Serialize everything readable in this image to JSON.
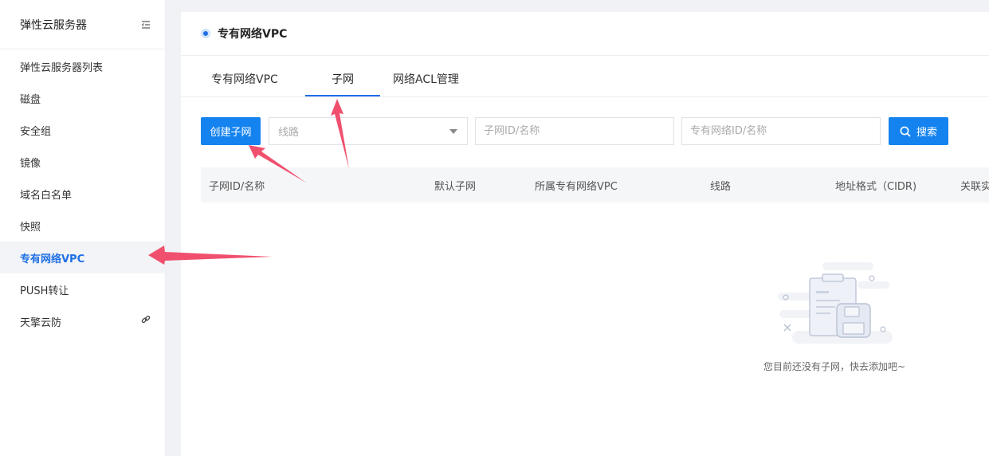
{
  "sidebar": {
    "title": "弹性云服务器",
    "items": [
      {
        "label": "弹性云服务器列表"
      },
      {
        "label": "磁盘"
      },
      {
        "label": "安全组"
      },
      {
        "label": "镜像"
      },
      {
        "label": "域名白名单"
      },
      {
        "label": "快照"
      },
      {
        "label": "专有网络VPC",
        "active": true
      },
      {
        "label": "PUSH转让"
      },
      {
        "label": "天擎云防",
        "icon": "link-icon"
      }
    ]
  },
  "page": {
    "title": "专有网络VPC"
  },
  "tabs": [
    {
      "label": "专有网络VPC"
    },
    {
      "label": "子网",
      "active": true
    },
    {
      "label": "网络ACL管理"
    }
  ],
  "toolbar": {
    "create_label": "创建子网",
    "line_placeholder": "线路",
    "subnet_placeholder": "子网ID/名称",
    "vpc_placeholder": "专有网络ID/名称",
    "search_label": "搜索"
  },
  "table": {
    "columns": [
      "子网ID/名称",
      "默认子网",
      "所属专有网络VPC",
      "线路",
      "地址格式（CIDR)",
      "关联实"
    ]
  },
  "empty": {
    "message": "您目前还没有子网，快去添加吧~"
  },
  "colors": {
    "accent": "#1483f0",
    "active_nav": "#1e6fe6",
    "annotation_arrow": "#f0506e"
  }
}
